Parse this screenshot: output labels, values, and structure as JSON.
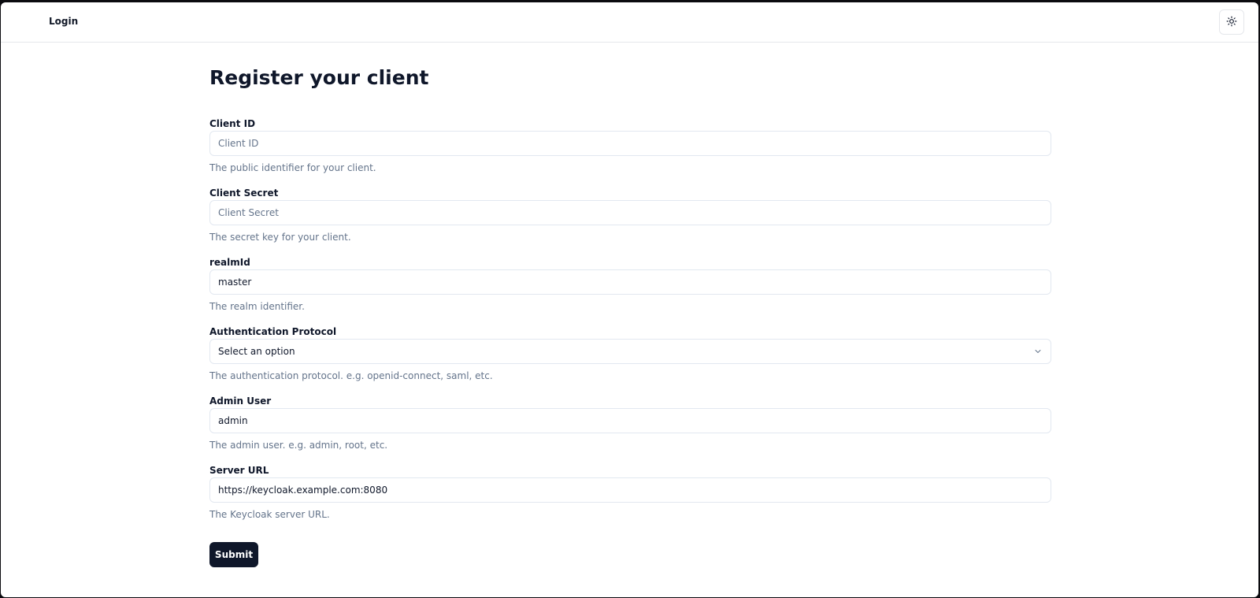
{
  "header": {
    "login_label": "Login",
    "theme_icon": "sun-icon"
  },
  "form": {
    "title": "Register your client",
    "fields": [
      {
        "label": "Client ID",
        "placeholder": "Client ID",
        "value": "",
        "help": "The public identifier for your client."
      },
      {
        "label": "Client Secret",
        "placeholder": "Client Secret",
        "value": "",
        "help": "The secret key for your client."
      },
      {
        "label": "realmId",
        "placeholder": "",
        "value": "master",
        "help": "The realm identifier."
      },
      {
        "label": "Authentication Protocol",
        "selected": "Select an option",
        "help": "The authentication protocol. e.g. openid-connect, saml, etc."
      },
      {
        "label": "Admin User",
        "placeholder": "",
        "value": "admin",
        "help": "The admin user. e.g. admin, root, etc."
      },
      {
        "label": "Server URL",
        "placeholder": "",
        "value": "https://keycloak.example.com:8080",
        "help": "The Keycloak server URL."
      }
    ],
    "submit_label": "Submit"
  },
  "colors": {
    "primary": "#0f172a",
    "muted_text": "#64748b",
    "border": "#e2e8f0"
  }
}
